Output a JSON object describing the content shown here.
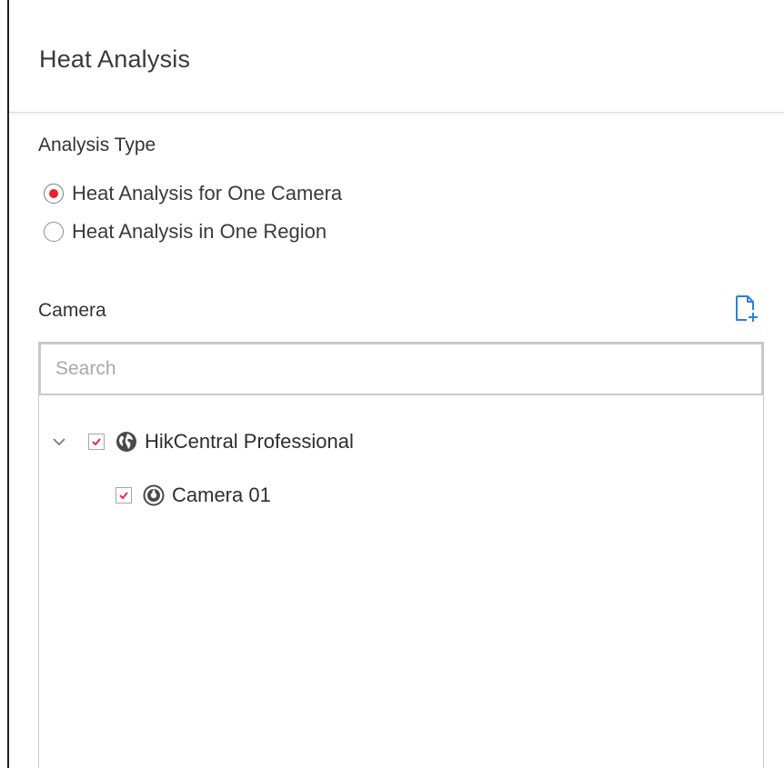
{
  "header": {
    "title": "Heat Analysis"
  },
  "analysis_type": {
    "label": "Analysis Type",
    "options": [
      {
        "label": "Heat Analysis for One Camera",
        "selected": true
      },
      {
        "label": "Heat Analysis in One Region",
        "selected": false
      }
    ]
  },
  "camera": {
    "label": "Camera",
    "add_icon": "add-file-icon",
    "search": {
      "placeholder": "Search",
      "value": ""
    },
    "tree": {
      "root": {
        "label": "HikCentral Professional",
        "checked": true,
        "expanded": true,
        "icon": "globe-icon"
      },
      "children": [
        {
          "label": "Camera 01",
          "checked": true,
          "icon": "camera-icon"
        }
      ]
    }
  },
  "colors": {
    "accent": "#e8202a",
    "link_blue": "#2f80d8",
    "icon_gray": "#4a4a4a",
    "border": "#c8c8c8"
  }
}
